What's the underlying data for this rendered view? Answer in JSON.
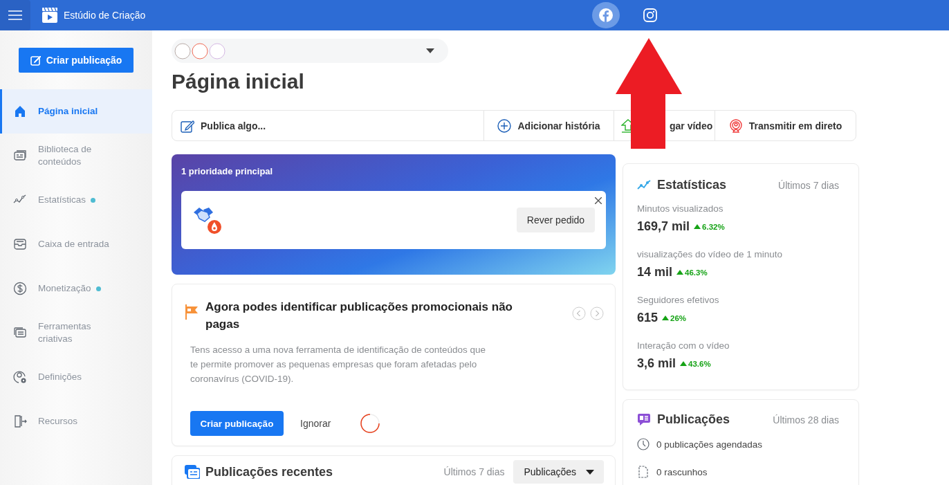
{
  "app": {
    "title": "Estúdio de Criação"
  },
  "platforms": [
    {
      "kind": "facebook",
      "selected": true
    },
    {
      "kind": "instagram",
      "selected": false
    }
  ],
  "sidebar": {
    "create_button": "Criar publicação",
    "items": [
      {
        "kind": "home",
        "label": "Página inicial",
        "selected": true,
        "notification": false
      },
      {
        "kind": "library",
        "label": "Biblioteca de conteúdos",
        "selected": false,
        "notification": false
      },
      {
        "kind": "stats",
        "label": "Estatísticas",
        "selected": false,
        "notification": true
      },
      {
        "kind": "inbox",
        "label": "Caixa de entrada",
        "selected": false,
        "notification": false
      },
      {
        "kind": "money",
        "label": "Monetização",
        "selected": false,
        "notification": true
      },
      {
        "kind": "tools",
        "label": "Ferramentas criativas",
        "selected": false,
        "notification": false
      },
      {
        "kind": "settings",
        "label": "Definições",
        "selected": false,
        "notification": false
      },
      {
        "kind": "resources",
        "label": "Recursos",
        "selected": false,
        "notification": false
      }
    ]
  },
  "heading": "Página inicial",
  "actions": [
    {
      "kind": "edit",
      "label": "Publica algo..."
    },
    {
      "kind": "add",
      "label": "Adicionar história"
    },
    {
      "kind": "upload",
      "label": "gar vídeo"
    },
    {
      "kind": "live",
      "label": "Transmitir em direto"
    }
  ],
  "priority": {
    "title": "1 prioridade principal",
    "button": "Rever pedido"
  },
  "promo": {
    "title": "Agora podes identificar publicações promocionais não pagas",
    "body": "Tens acesso a uma nova ferramenta de identificação de conteúdos que te permite promover as pequenas empresas que foram afetadas pelo coronavírus (COVID-19).",
    "primary": "Criar publicação",
    "secondary": "Ignorar"
  },
  "recent": {
    "title": "Publicações recentes",
    "period": "Últimos 7 dias",
    "filter": "Publicações"
  },
  "stats": {
    "title": "Estatísticas",
    "period": "Últimos 7 dias",
    "metrics": [
      {
        "label": "Minutos visualizados",
        "value": "169,7 mil",
        "change": "6.32%"
      },
      {
        "label": "visualizações do vídeo de 1 minuto",
        "value": "14 mil",
        "change": "46.3%"
      },
      {
        "label": "Seguidores efetivos",
        "value": "615",
        "change": "26%"
      },
      {
        "label": "Interação com o vídeo",
        "value": "3,6 mil",
        "change": "43.6%"
      }
    ]
  },
  "posts": {
    "title": "Publicações",
    "period": "Últimos 28 dias",
    "items": [
      {
        "kind": "clock",
        "label": "0 publicações agendadas"
      },
      {
        "kind": "draft",
        "label": "0 rascunhos"
      }
    ]
  },
  "annotation": {
    "kind": "arrow"
  }
}
